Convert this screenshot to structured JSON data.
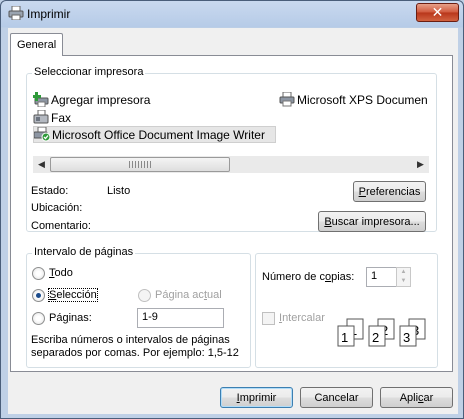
{
  "window": {
    "title": "Imprimir",
    "close_glyph": "✕",
    "close_color": "#c94a2f"
  },
  "tabs": [
    {
      "label": "General"
    }
  ],
  "select_printer": {
    "group_label": "Seleccionar impresora",
    "printers": [
      {
        "label": "Agregar impresora",
        "icon": "add-printer-icon"
      },
      {
        "label": "Microsoft XPS Documen",
        "icon": "printer-icon"
      },
      {
        "label": "Fax",
        "icon": "fax-icon"
      },
      {
        "label": "Microsoft Office Document Image Writer",
        "icon": "default-printer-icon",
        "selected": true
      }
    ],
    "status_label": "Estado:",
    "status_value": "Listo",
    "location_label": "Ubicación:",
    "comment_label": "Comentario:",
    "preferences_button": {
      "before": "",
      "hotkey": "P",
      "after": "referencias"
    },
    "find_printer_button": {
      "before": "",
      "hotkey": "B",
      "after": "uscar impresora..."
    }
  },
  "page_range": {
    "group_label": "Intervalo de páginas",
    "all": {
      "before": "",
      "hotkey": "T",
      "after": "odo"
    },
    "selection": {
      "before": "",
      "hotkey": "S",
      "after": "elección",
      "checked": true
    },
    "current_page": {
      "before": "Página ac",
      "hotkey": "t",
      "after": "ual"
    },
    "pages": {
      "before": "Pá",
      "hotkey": "g",
      "after": "inas:"
    },
    "pages_value": "1-9",
    "hint_line1": "Escriba números o intervalos de páginas",
    "hint_line2": "separados por comas. Por ejemplo: 1,5-12"
  },
  "copies": {
    "label_before": "Número de c",
    "label_hotkey": "o",
    "label_after": "pias:",
    "value": "1",
    "collate_before": "",
    "collate_hotkey": "I",
    "collate_after": "ntercalar",
    "collate_pages": [
      "1",
      "1",
      "2",
      "2",
      "3",
      "3"
    ]
  },
  "buttons": {
    "print": {
      "before": "",
      "hotkey": "I",
      "after": "mprimir"
    },
    "cancel": "Cancelar",
    "apply": {
      "before": "Apli",
      "hotkey": "c",
      "after": "ar"
    }
  }
}
